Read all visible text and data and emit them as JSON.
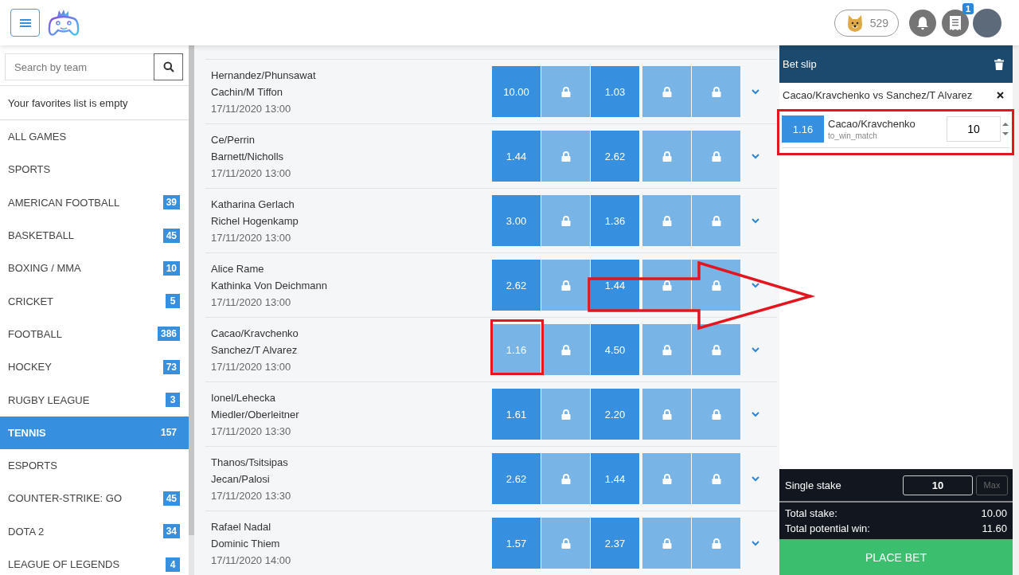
{
  "header": {
    "coins": "529",
    "notification_badge": "1"
  },
  "sidebar": {
    "search": {
      "placeholder": "Search by team"
    },
    "favorites_message": "Your favorites list is empty",
    "items": [
      {
        "label": "ALL GAMES",
        "selected": false
      },
      {
        "label": "SPORTS",
        "selected": false
      },
      {
        "label": "AMERICAN FOOTBALL",
        "count": "39",
        "selected": false
      },
      {
        "label": "BASKETBALL",
        "count": "45",
        "selected": false
      },
      {
        "label": "BOXING / MMA",
        "count": "10",
        "selected": false
      },
      {
        "label": "CRICKET",
        "count": "5",
        "selected": false
      },
      {
        "label": "FOOTBALL",
        "count": "386",
        "selected": false
      },
      {
        "label": "HOCKEY",
        "count": "73",
        "selected": false
      },
      {
        "label": "RUGBY LEAGUE",
        "count": "3",
        "selected": false
      },
      {
        "label": "TENNIS",
        "count": "157",
        "selected": true
      },
      {
        "label": "ESPORTS",
        "selected": false
      },
      {
        "label": "COUNTER-STRIKE: GO",
        "count": "45",
        "selected": false
      },
      {
        "label": "DOTA 2",
        "count": "34",
        "selected": false
      },
      {
        "label": "LEAGUE OF LEGENDS",
        "count": "4",
        "selected": false
      }
    ]
  },
  "matches": [
    {
      "team_1": "Hernandez/Phunsawat",
      "team_2": "Cachin/M Tiffon",
      "time": "17/11/2020 13:00",
      "odds": [
        {
          "kind": "odds",
          "value": "10.00",
          "selected": false
        },
        {
          "kind": "locked",
          "selected": false
        },
        {
          "kind": "odds",
          "value": "1.03",
          "selected": false
        },
        {
          "kind": "locked",
          "selected": false
        },
        {
          "kind": "locked",
          "selected": false
        }
      ]
    },
    {
      "team_1": "Ce/Perrin",
      "team_2": "Barnett/Nicholls",
      "time": "17/11/2020 13:00",
      "odds": [
        {
          "kind": "odds",
          "value": "1.44",
          "selected": false
        },
        {
          "kind": "locked",
          "selected": false
        },
        {
          "kind": "odds",
          "value": "2.62",
          "selected": false
        },
        {
          "kind": "locked",
          "selected": false
        },
        {
          "kind": "locked",
          "selected": false
        }
      ]
    },
    {
      "team_1": "Katharina Gerlach",
      "team_2": "Richel Hogenkamp",
      "time": "17/11/2020 13:00",
      "odds": [
        {
          "kind": "odds",
          "value": "3.00",
          "selected": false
        },
        {
          "kind": "locked",
          "selected": false
        },
        {
          "kind": "odds",
          "value": "1.36",
          "selected": false
        },
        {
          "kind": "locked",
          "selected": false
        },
        {
          "kind": "locked",
          "selected": false
        }
      ]
    },
    {
      "team_1": "Alice Rame",
      "team_2": "Kathinka Von Deichmann",
      "time": "17/11/2020 13:00",
      "odds": [
        {
          "kind": "odds",
          "value": "2.62",
          "selected": false
        },
        {
          "kind": "locked",
          "selected": false
        },
        {
          "kind": "odds",
          "value": "1.44",
          "selected": false
        },
        {
          "kind": "locked",
          "selected": false
        },
        {
          "kind": "locked",
          "selected": false
        }
      ]
    },
    {
      "team_1": "Cacao/Kravchenko",
      "team_2": "Sanchez/T Alvarez",
      "time": "17/11/2020 13:00",
      "odds": [
        {
          "kind": "odds",
          "value": "1.16",
          "selected": true
        },
        {
          "kind": "locked",
          "selected": false
        },
        {
          "kind": "odds",
          "value": "4.50",
          "selected": false
        },
        {
          "kind": "locked",
          "selected": false
        },
        {
          "kind": "locked",
          "selected": false
        }
      ]
    },
    {
      "team_1": "Ionel/Lehecka",
      "team_2": "Miedler/Oberleitner",
      "time": "17/11/2020 13:30",
      "odds": [
        {
          "kind": "odds",
          "value": "1.61",
          "selected": false
        },
        {
          "kind": "locked",
          "selected": false
        },
        {
          "kind": "odds",
          "value": "2.20",
          "selected": false
        },
        {
          "kind": "locked",
          "selected": false
        },
        {
          "kind": "locked",
          "selected": false
        }
      ]
    },
    {
      "team_1": "Thanos/Tsitsipas",
      "team_2": "Jecan/Palosi",
      "time": "17/11/2020 13:30",
      "odds": [
        {
          "kind": "odds",
          "value": "2.62",
          "selected": false
        },
        {
          "kind": "locked",
          "selected": false
        },
        {
          "kind": "odds",
          "value": "1.44",
          "selected": false
        },
        {
          "kind": "locked",
          "selected": false
        },
        {
          "kind": "locked",
          "selected": false
        }
      ]
    },
    {
      "team_1": "Rafael Nadal",
      "team_2": "Dominic Thiem",
      "time": "17/11/2020 14:00",
      "odds": [
        {
          "kind": "odds",
          "value": "1.57",
          "selected": false
        },
        {
          "kind": "locked",
          "selected": false
        },
        {
          "kind": "odds",
          "value": "2.37",
          "selected": false
        },
        {
          "kind": "locked",
          "selected": false
        },
        {
          "kind": "locked",
          "selected": false
        }
      ]
    }
  ],
  "bet_slip": {
    "title": "Bet slip",
    "event": "Cacao/Kravchenko vs Sanchez/T Alvarez",
    "selection": {
      "odds": "1.16",
      "name": "Cacao/Kravchenko",
      "market": "to_win_match",
      "stake": "10"
    },
    "single_stake_label": "Single stake",
    "single_stake": "10",
    "max_button": "Max",
    "totals": [
      {
        "label": "Total stake:",
        "value": "10.00"
      },
      {
        "label": "Total potential win:",
        "value": "11.60"
      }
    ],
    "place_bet": "PLACE BET"
  }
}
